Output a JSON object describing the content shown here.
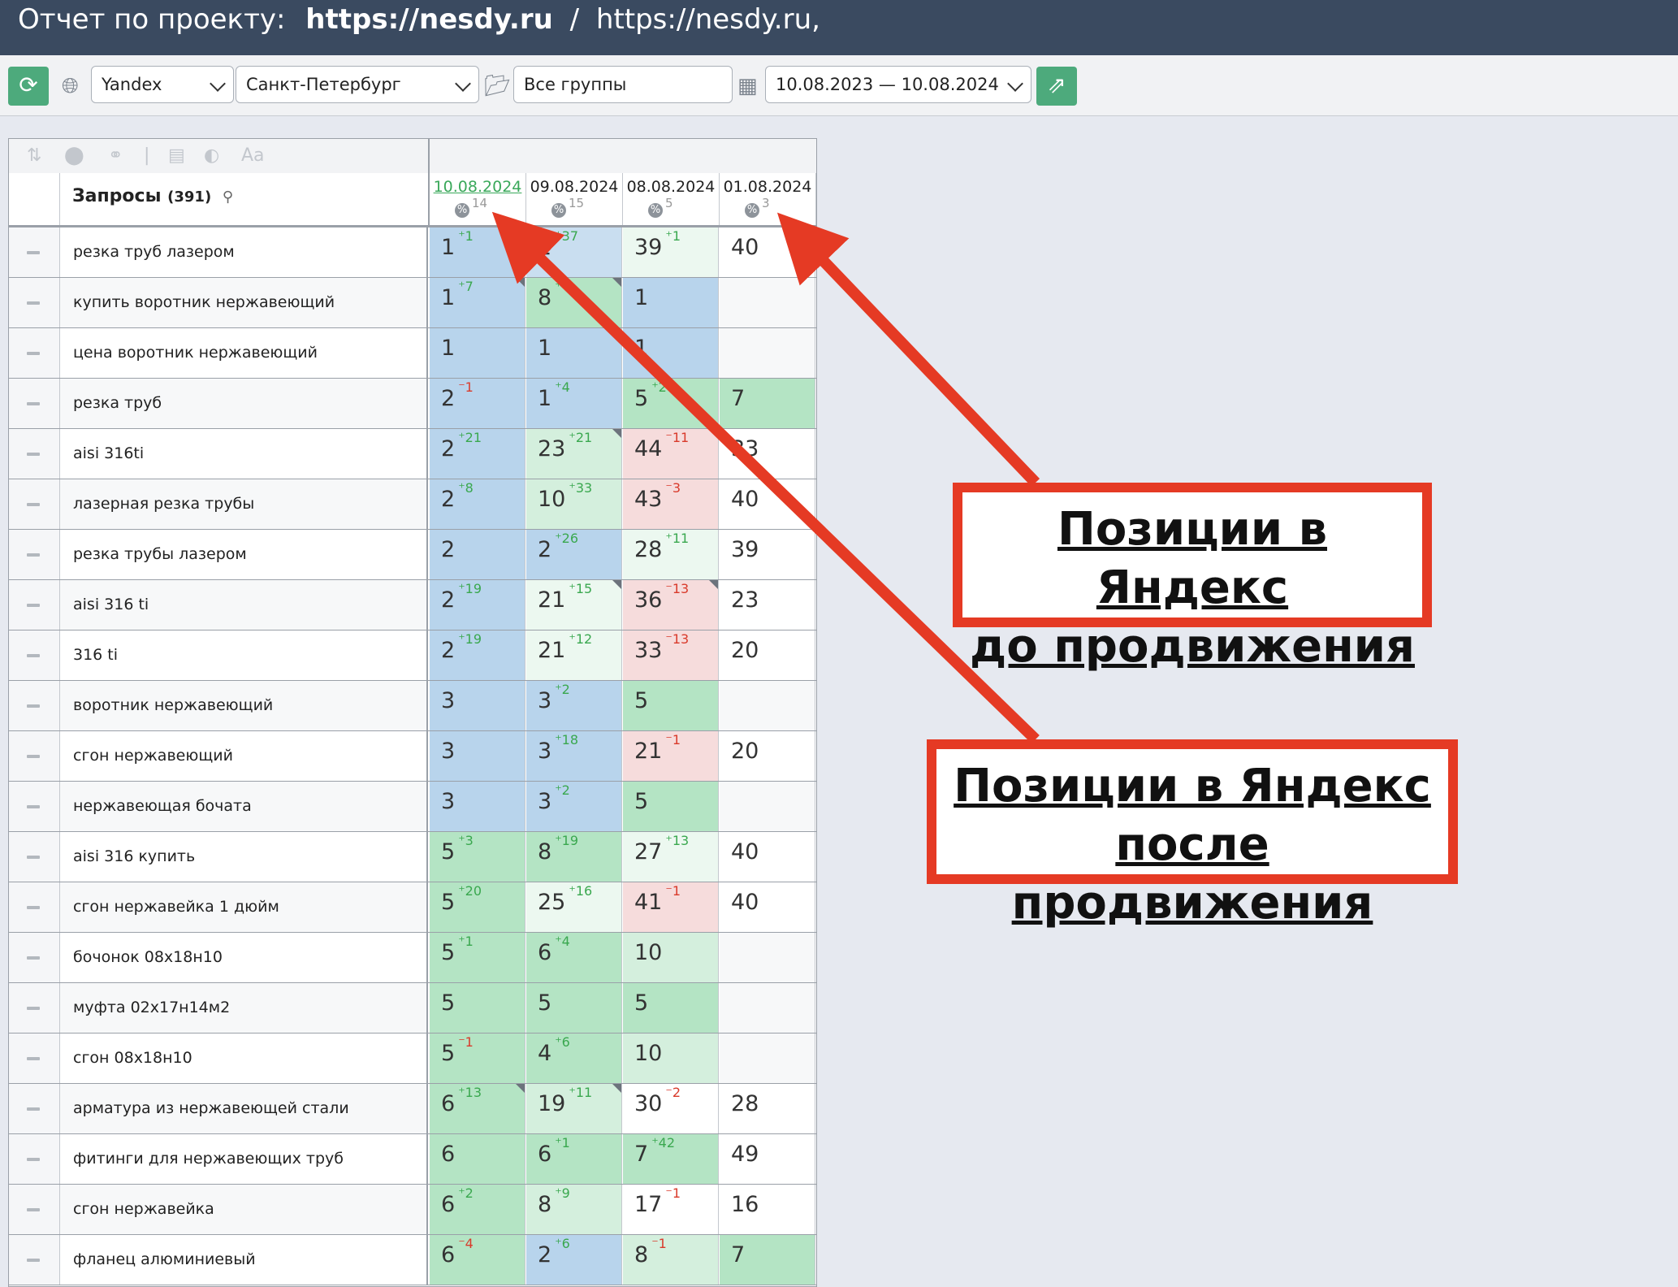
{
  "header": {
    "prefix": "Отчет по проекту:",
    "domain": "https://nesdy.ru",
    "separator": "/",
    "url": "https://nesdy.ru,"
  },
  "toolbar": {
    "search_engine": "Yandex",
    "region": "Санкт-Петербург",
    "group": "Все группы",
    "date_range": "10.08.2023 — 10.08.2024"
  },
  "icons": {
    "refresh": "refresh-icon",
    "globe": "globe-icon",
    "folder": "folder-icon",
    "calendar": "calendar-icon",
    "export": "export-icon"
  },
  "table": {
    "query_header": "Запросы",
    "query_count": "(391)",
    "dates": [
      {
        "date": "10.08.2024",
        "count": "14",
        "active": true
      },
      {
        "date": "09.08.2024",
        "count": "15",
        "active": false
      },
      {
        "date": "08.08.2024",
        "count": "5",
        "active": false
      },
      {
        "date": "01.08.2024",
        "count": "3",
        "active": false
      }
    ],
    "rows": [
      {
        "query": "резка труб лазером",
        "cells": [
          {
            "v": "1",
            "d": "1",
            "t": "up",
            "bg": "blue"
          },
          {
            "v": "2",
            "d": "37",
            "t": "up",
            "bg": "lblue"
          },
          {
            "v": "39",
            "d": "1",
            "t": "up",
            "bg": "vlgreen"
          },
          {
            "v": "40",
            "bg": "white"
          }
        ]
      },
      {
        "query": "купить воротник нержавеющий",
        "cells": [
          {
            "v": "1",
            "d": "7",
            "t": "up",
            "bg": "blue",
            "corner": true
          },
          {
            "v": "8",
            "d": "",
            "t": "up",
            "bg": "green",
            "corner": true
          },
          {
            "v": "1",
            "bg": "blue"
          },
          {
            "v": "",
            "bg": "grey"
          }
        ]
      },
      {
        "query": "цена воротник нержавеющий",
        "cells": [
          {
            "v": "1",
            "bg": "blue"
          },
          {
            "v": "1",
            "bg": "blue"
          },
          {
            "v": "1",
            "bg": "blue"
          },
          {
            "v": "",
            "bg": "grey"
          }
        ]
      },
      {
        "query": "резка труб",
        "cells": [
          {
            "v": "2",
            "d": "1",
            "t": "down",
            "bg": "blue"
          },
          {
            "v": "1",
            "d": "4",
            "t": "up",
            "bg": "blue"
          },
          {
            "v": "5",
            "d": "2",
            "t": "up",
            "bg": "green"
          },
          {
            "v": "7",
            "bg": "green"
          }
        ]
      },
      {
        "query": "aisi 316ti",
        "cells": [
          {
            "v": "2",
            "d": "21",
            "t": "up",
            "bg": "blue"
          },
          {
            "v": "23",
            "d": "21",
            "t": "up",
            "bg": "lgreen",
            "corner": true
          },
          {
            "v": "44",
            "d": "11",
            "t": "down",
            "bg": "pink"
          },
          {
            "v": "33",
            "bg": "white"
          }
        ]
      },
      {
        "query": "лазерная резка трубы",
        "cells": [
          {
            "v": "2",
            "d": "8",
            "t": "up",
            "bg": "blue"
          },
          {
            "v": "10",
            "d": "33",
            "t": "up",
            "bg": "lgreen"
          },
          {
            "v": "43",
            "d": "3",
            "t": "down",
            "bg": "pink"
          },
          {
            "v": "40",
            "bg": "white"
          }
        ]
      },
      {
        "query": "резка трубы лазером",
        "cells": [
          {
            "v": "2",
            "bg": "blue"
          },
          {
            "v": "2",
            "d": "26",
            "t": "up",
            "bg": "blue"
          },
          {
            "v": "28",
            "d": "11",
            "t": "up",
            "bg": "vlgreen"
          },
          {
            "v": "39",
            "bg": "white"
          }
        ]
      },
      {
        "query": "aisi 316 ti",
        "cells": [
          {
            "v": "2",
            "d": "19",
            "t": "up",
            "bg": "blue"
          },
          {
            "v": "21",
            "d": "15",
            "t": "up",
            "bg": "vlgreen",
            "corner": true
          },
          {
            "v": "36",
            "d": "13",
            "t": "down",
            "bg": "pink",
            "corner": true
          },
          {
            "v": "23",
            "bg": "white"
          }
        ]
      },
      {
        "query": "316 ti",
        "cells": [
          {
            "v": "2",
            "d": "19",
            "t": "up",
            "bg": "blue"
          },
          {
            "v": "21",
            "d": "12",
            "t": "up",
            "bg": "vlgreen"
          },
          {
            "v": "33",
            "d": "13",
            "t": "down",
            "bg": "pink"
          },
          {
            "v": "20",
            "bg": "white"
          }
        ]
      },
      {
        "query": "воротник нержавеющий",
        "cells": [
          {
            "v": "3",
            "bg": "blue"
          },
          {
            "v": "3",
            "d": "2",
            "t": "up",
            "bg": "blue"
          },
          {
            "v": "5",
            "bg": "green"
          },
          {
            "v": "",
            "bg": "grey"
          }
        ]
      },
      {
        "query": "сгон нержавеющий",
        "cells": [
          {
            "v": "3",
            "bg": "blue"
          },
          {
            "v": "3",
            "d": "18",
            "t": "up",
            "bg": "blue"
          },
          {
            "v": "21",
            "d": "1",
            "t": "down",
            "bg": "pink"
          },
          {
            "v": "20",
            "bg": "white"
          }
        ]
      },
      {
        "query": "нержавеющая бочата",
        "cells": [
          {
            "v": "3",
            "bg": "blue"
          },
          {
            "v": "3",
            "d": "2",
            "t": "up",
            "bg": "blue"
          },
          {
            "v": "5",
            "bg": "green"
          },
          {
            "v": "",
            "bg": "grey"
          }
        ]
      },
      {
        "query": "aisi 316 купить",
        "cells": [
          {
            "v": "5",
            "d": "3",
            "t": "up",
            "bg": "green"
          },
          {
            "v": "8",
            "d": "19",
            "t": "up",
            "bg": "green"
          },
          {
            "v": "27",
            "d": "13",
            "t": "up",
            "bg": "vlgreen"
          },
          {
            "v": "40",
            "bg": "white"
          }
        ]
      },
      {
        "query": "сгон нержавейка 1 дюйм",
        "cells": [
          {
            "v": "5",
            "d": "20",
            "t": "up",
            "bg": "green"
          },
          {
            "v": "25",
            "d": "16",
            "t": "up",
            "bg": "vlgreen"
          },
          {
            "v": "41",
            "d": "1",
            "t": "down",
            "bg": "pink"
          },
          {
            "v": "40",
            "bg": "white"
          }
        ]
      },
      {
        "query": "бочонок 08х18н10",
        "cells": [
          {
            "v": "5",
            "d": "1",
            "t": "up",
            "bg": "green"
          },
          {
            "v": "6",
            "d": "4",
            "t": "up",
            "bg": "green"
          },
          {
            "v": "10",
            "bg": "lgreen"
          },
          {
            "v": "",
            "bg": "grey"
          }
        ]
      },
      {
        "query": "муфта 02х17н14м2",
        "cells": [
          {
            "v": "5",
            "bg": "green"
          },
          {
            "v": "5",
            "bg": "green"
          },
          {
            "v": "5",
            "bg": "green"
          },
          {
            "v": "",
            "bg": "grey"
          }
        ]
      },
      {
        "query": "сгон 08х18н10",
        "cells": [
          {
            "v": "5",
            "d": "1",
            "t": "down",
            "bg": "green"
          },
          {
            "v": "4",
            "d": "6",
            "t": "up",
            "bg": "green"
          },
          {
            "v": "10",
            "bg": "lgreen"
          },
          {
            "v": "",
            "bg": "grey"
          }
        ]
      },
      {
        "query": "арматура из нержавеющей стали",
        "cells": [
          {
            "v": "6",
            "d": "13",
            "t": "up",
            "bg": "green",
            "corner": true
          },
          {
            "v": "19",
            "d": "11",
            "t": "up",
            "bg": "lgreen",
            "corner": true
          },
          {
            "v": "30",
            "d": "2",
            "t": "down",
            "bg": "white"
          },
          {
            "v": "28",
            "bg": "white"
          }
        ]
      },
      {
        "query": "фитинги для нержавеющих труб",
        "cells": [
          {
            "v": "6",
            "bg": "green"
          },
          {
            "v": "6",
            "d": "1",
            "t": "up",
            "bg": "green"
          },
          {
            "v": "7",
            "d": "42",
            "t": "up",
            "bg": "green"
          },
          {
            "v": "49",
            "bg": "white"
          }
        ]
      },
      {
        "query": "сгон нержавейка",
        "cells": [
          {
            "v": "6",
            "d": "2",
            "t": "up",
            "bg": "green"
          },
          {
            "v": "8",
            "d": "9",
            "t": "up",
            "bg": "lgreen"
          },
          {
            "v": "17",
            "d": "1",
            "t": "down",
            "bg": "white"
          },
          {
            "v": "16",
            "bg": "white"
          }
        ]
      },
      {
        "query": "фланец алюминиевый",
        "cells": [
          {
            "v": "6",
            "d": "4",
            "t": "down",
            "bg": "green"
          },
          {
            "v": "2",
            "d": "6",
            "t": "up",
            "bg": "blue"
          },
          {
            "v": "8",
            "d": "1",
            "t": "down",
            "bg": "lgreen"
          },
          {
            "v": "7",
            "bg": "green"
          }
        ]
      }
    ]
  },
  "annotations": {
    "before": [
      "Позиции в Яндекс",
      "до продвижения"
    ],
    "after": [
      "Позиции в Яндекс",
      "после продвижения"
    ],
    "color": "#e53a24"
  },
  "colors": {
    "header_bg": "#3a4a60",
    "accent_green": "#4daa7c"
  }
}
